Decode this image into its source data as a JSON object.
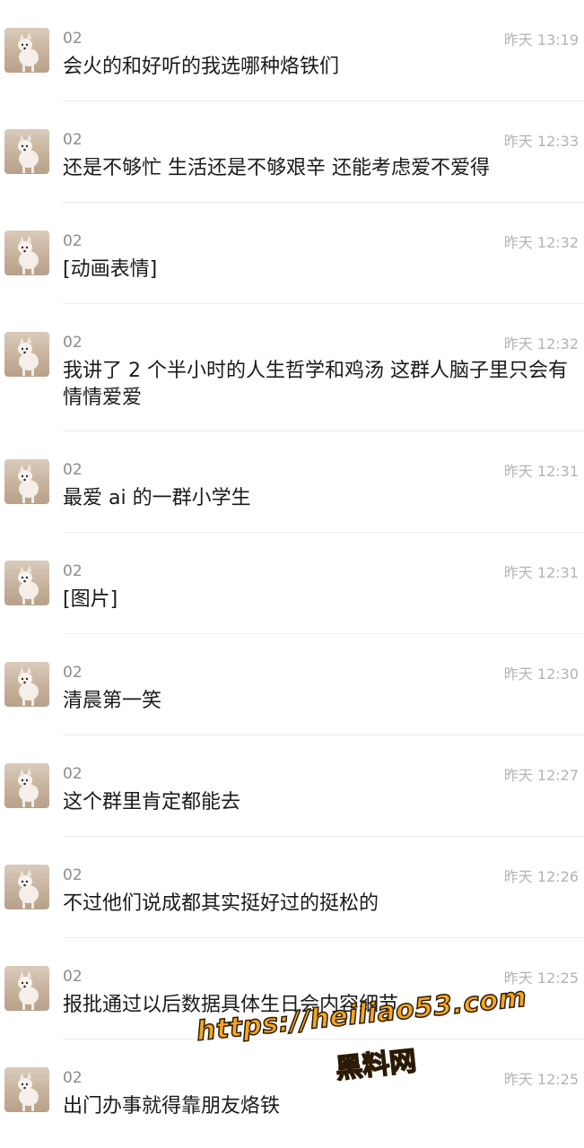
{
  "messages": [
    {
      "sender": "02",
      "time": "昨天 13:19",
      "text": "会火的和好听的我选哪种烙铁们"
    },
    {
      "sender": "02",
      "time": "昨天 12:33",
      "text": "还是不够忙 生活还是不够艰辛 还能考虑爱不爱得"
    },
    {
      "sender": "02",
      "time": "昨天 12:32",
      "text": "[动画表情]"
    },
    {
      "sender": "02",
      "time": "昨天 12:32",
      "text": "我讲了 2 个半小时的人生哲学和鸡汤 这群人脑子里只会有情情爱爱"
    },
    {
      "sender": "02",
      "time": "昨天 12:31",
      "text": "最爱 ai 的一群小学生"
    },
    {
      "sender": "02",
      "time": "昨天 12:31",
      "text": "[图片]"
    },
    {
      "sender": "02",
      "time": "昨天 12:30",
      "text": "清晨第一笑"
    },
    {
      "sender": "02",
      "time": "昨天 12:27",
      "text": "这个群里肯定都能去"
    },
    {
      "sender": "02",
      "time": "昨天 12:26",
      "text": "不过他们说成都其实挺好过的挺松的"
    },
    {
      "sender": "02",
      "time": "昨天 12:25",
      "text": "报批通过以后数据具体生日会内容细节"
    },
    {
      "sender": "02",
      "time": "昨天 12:25",
      "text": "出门办事就得靠朋友烙铁"
    }
  ],
  "watermark": {
    "url": "https://heiliao53.com",
    "name": "黑料网"
  },
  "colors": {
    "sender": "#8c8c8c",
    "time": "#b3b3b3",
    "text": "#1a1a1a",
    "watermark": "#f5a623"
  }
}
